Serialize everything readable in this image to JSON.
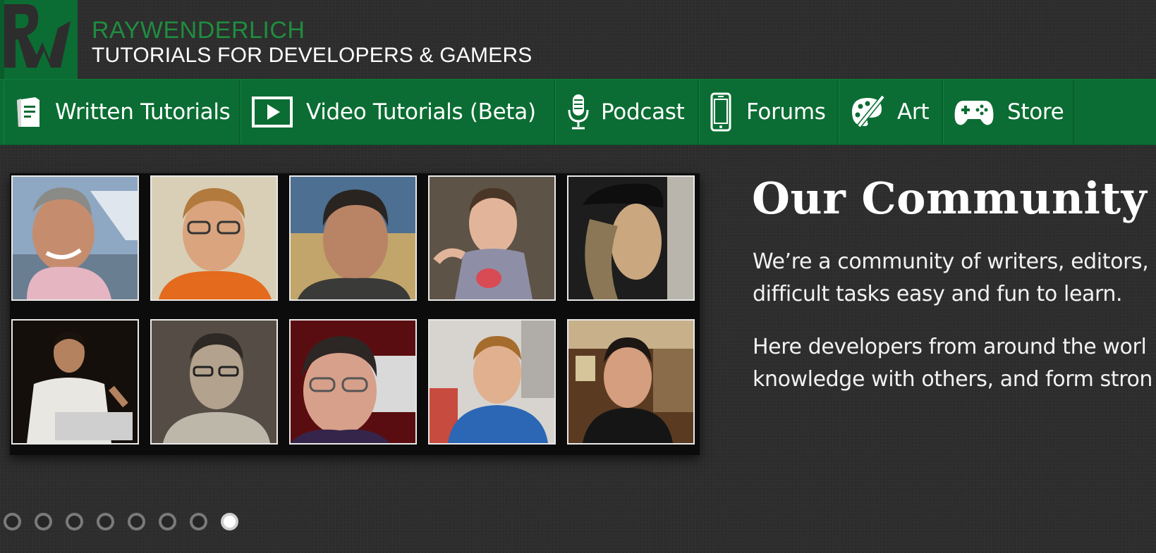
{
  "header": {
    "brand_name": "RAYWENDERLICH",
    "tagline": "TUTORIALS FOR DEVELOPERS & GAMERS",
    "brand_color": "#1f8d3f",
    "logo_icon": "rw-logo-icon"
  },
  "nav": {
    "background": "#0b6d33",
    "items": [
      {
        "label": "Written Tutorials",
        "icon": "document-icon"
      },
      {
        "label": "Video Tutorials (Beta)",
        "icon": "video-play-icon"
      },
      {
        "label": "Podcast",
        "icon": "microphone-icon"
      },
      {
        "label": "Forums",
        "icon": "phone-icon"
      },
      {
        "label": "Art",
        "icon": "paintbrush-palette-icon"
      },
      {
        "label": "Store",
        "icon": "gamepad-icon"
      }
    ]
  },
  "community": {
    "title": "Our Community",
    "paragraph1_line1": "We’re a community of writers, editors,",
    "paragraph1_line2": "difficult tasks easy and fun to learn.",
    "paragraph2_line1": "Here developers from around the worl",
    "paragraph2_line2": "knowledge with others, and form stron"
  },
  "pager": {
    "dot_count": 8,
    "active_index": 7
  }
}
